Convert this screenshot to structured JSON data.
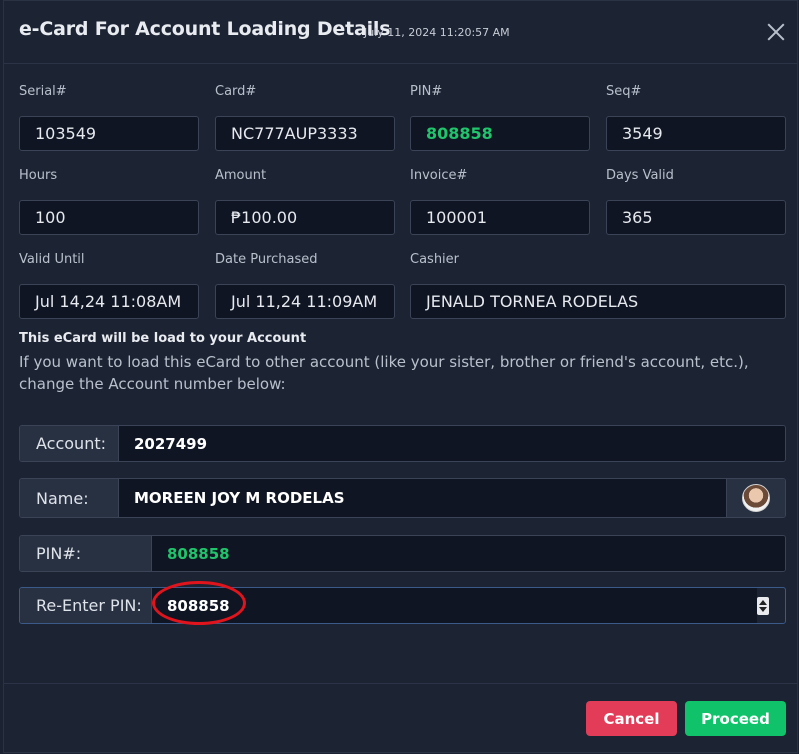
{
  "header": {
    "title": "e-Card For Account Loading Details",
    "timestamp": "July 11, 2024 11:20:57 AM"
  },
  "fields": [
    {
      "label": "Serial#",
      "value": "103549"
    },
    {
      "label": "Card#",
      "value": "NC777AUP3333"
    },
    {
      "label": "PIN#",
      "value": "808858"
    },
    {
      "label": "Seq#",
      "value": "3549"
    },
    {
      "label": "Hours",
      "value": "100"
    },
    {
      "label": "Amount",
      "value": "₱100.00"
    },
    {
      "label": "Invoice#",
      "value": "100001"
    },
    {
      "label": "Days Valid",
      "value": "365"
    },
    {
      "label": "Valid Until",
      "value": "Jul 14,24 11:08AM"
    },
    {
      "label": "Date Purchased",
      "value": "Jul 11,24 11:09AM"
    },
    {
      "label": "Cashier",
      "value": "JENALD TORNEA RODELAS"
    }
  ],
  "notice": {
    "title": "This eCard will be load to your Account",
    "body": "If you want to load this eCard to other account (like your sister, brother or friend's account, etc.), change the Account number below:"
  },
  "account_form": {
    "account_label": "Account:",
    "account_value": "2027499",
    "name_label": "Name:",
    "name_value": "MOREEN JOY M RODELAS",
    "pin_label": "PIN#:",
    "pin_value": "808858",
    "reenter_label": "Re-Enter PIN:",
    "reenter_value": "808858"
  },
  "footer": {
    "cancel_label": "Cancel",
    "proceed_label": "Proceed"
  },
  "colors": {
    "pin_green": "#20c46b",
    "cancel": "#e23c58",
    "proceed": "#10c36a",
    "highlight_circle": "#e0141c"
  }
}
